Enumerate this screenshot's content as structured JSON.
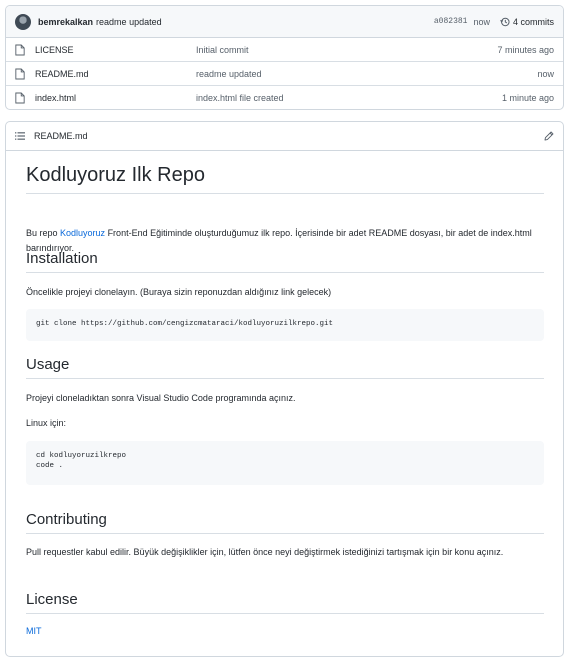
{
  "commit": {
    "author": "bemrekalkan",
    "message": "readme updated",
    "sha": "a082381",
    "time": "now",
    "commits_count": "4 commits"
  },
  "files": [
    {
      "name": "LICENSE",
      "commit": "Initial commit",
      "time": "7 minutes ago"
    },
    {
      "name": "README.md",
      "commit": "readme updated",
      "time": "now"
    },
    {
      "name": "index.html",
      "commit": "index.html file created",
      "time": "1 minute ago"
    }
  ],
  "readme": {
    "filename": "README.md",
    "title": "Kodluyoruz Ilk Repo",
    "intro_before": "Bu repo ",
    "intro_link": "Kodluyoruz",
    "intro_after": " Front-End Eğitiminde oluşturduğumuz ilk repo. İçerisinde bir adet README dosyası, bir adet de index.html barındırıyor.",
    "installation_heading": "Installation",
    "installation_text": "Öncelikle projeyi clonelayın. (Buraya sizin reponuzdan aldığınız link gelecek)",
    "installation_code": "git clone https://github.com/cengizcmataraci/kodluyoruzilkrepo.git",
    "usage_heading": "Usage",
    "usage_text": "Projeyi cloneladıktan sonra Visual Studio Code programında açınız.",
    "linux_text": "Linux için:",
    "usage_code": "cd kodluyoruzilkrepo\ncode .",
    "contributing_heading": "Contributing",
    "contributing_text": "Pull requestler kabul edilir. Büyük değişiklikler için, lütfen önce neyi değiştirmek istediğinizi tartışmak için bir konu açınız.",
    "license_heading": "License",
    "license_link": "MIT"
  },
  "colors": {
    "link": "#0969da",
    "border": "#d0d7de",
    "muted": "#57606a",
    "code_bg": "#f6f8fa"
  },
  "icons": {
    "avatar": "user-avatar",
    "history": "history-icon",
    "file": "file-icon",
    "readme_list": "list-icon",
    "edit": "pencil-icon"
  }
}
